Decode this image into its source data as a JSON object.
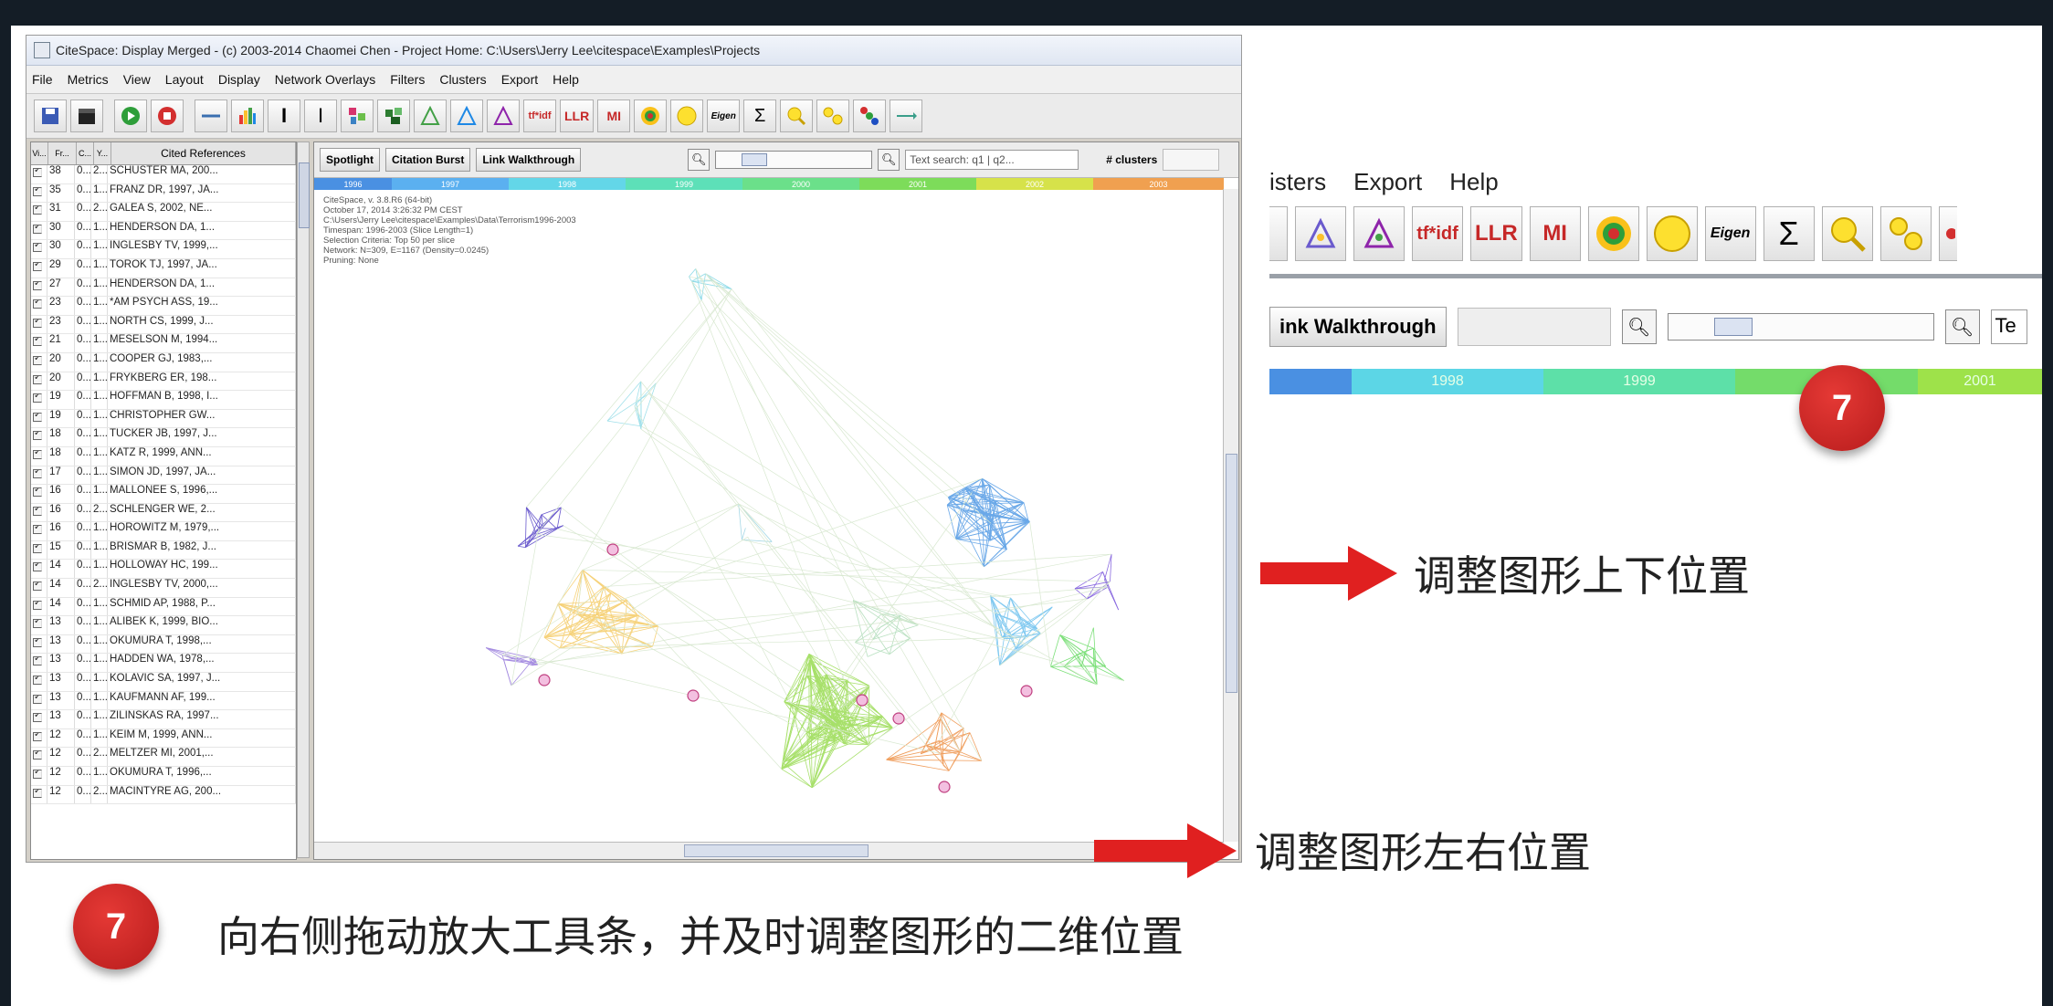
{
  "window": {
    "title": "CiteSpace: Display Merged - (c) 2003-2014 Chaomei Chen - Project Home: C:\\Users\\Jerry Lee\\citespace\\Examples\\Projects"
  },
  "menu": [
    "File",
    "Metrics",
    "View",
    "Layout",
    "Display",
    "Network Overlays",
    "Filters",
    "Clusters",
    "Export",
    "Help"
  ],
  "toolbar_text": {
    "tfidf": "tf*idf",
    "llr": "LLR",
    "mi": "MI",
    "eigen": "Eigen",
    "sigma": "Σ"
  },
  "table": {
    "headers": [
      "Vi...",
      "Fr...",
      "C...",
      "Y...",
      "Cited References"
    ],
    "rows": [
      {
        "freq": "38",
        "c": "0...",
        "y": "2...",
        "ref": "SCHUSTER MA, 200..."
      },
      {
        "freq": "35",
        "c": "0...",
        "y": "1...",
        "ref": "FRANZ DR, 1997, JA..."
      },
      {
        "freq": "31",
        "c": "0...",
        "y": "2...",
        "ref": "GALEA S, 2002, NE..."
      },
      {
        "freq": "30",
        "c": "0...",
        "y": "1...",
        "ref": "HENDERSON DA, 1..."
      },
      {
        "freq": "30",
        "c": "0...",
        "y": "1...",
        "ref": "INGLESBY TV, 1999,..."
      },
      {
        "freq": "29",
        "c": "0...",
        "y": "1...",
        "ref": "TOROK TJ, 1997, JA..."
      },
      {
        "freq": "27",
        "c": "0...",
        "y": "1...",
        "ref": "HENDERSON DA, 1..."
      },
      {
        "freq": "23",
        "c": "0...",
        "y": "1...",
        "ref": "*AM PSYCH ASS, 19..."
      },
      {
        "freq": "23",
        "c": "0...",
        "y": "1...",
        "ref": "NORTH CS, 1999, J..."
      },
      {
        "freq": "21",
        "c": "0...",
        "y": "1...",
        "ref": "MESELSON M, 1994..."
      },
      {
        "freq": "20",
        "c": "0...",
        "y": "1...",
        "ref": "COOPER GJ, 1983,..."
      },
      {
        "freq": "20",
        "c": "0...",
        "y": "1...",
        "ref": "FRYKBERG ER, 198..."
      },
      {
        "freq": "19",
        "c": "0...",
        "y": "1...",
        "ref": "HOFFMAN B, 1998, I..."
      },
      {
        "freq": "19",
        "c": "0...",
        "y": "1...",
        "ref": "CHRISTOPHER GW..."
      },
      {
        "freq": "18",
        "c": "0...",
        "y": "1...",
        "ref": "TUCKER JB, 1997, J..."
      },
      {
        "freq": "18",
        "c": "0...",
        "y": "1...",
        "ref": "KATZ R, 1999, ANN..."
      },
      {
        "freq": "17",
        "c": "0...",
        "y": "1...",
        "ref": "SIMON JD, 1997, JA..."
      },
      {
        "freq": "16",
        "c": "0...",
        "y": "1...",
        "ref": "MALLONEE S, 1996,..."
      },
      {
        "freq": "16",
        "c": "0...",
        "y": "2...",
        "ref": "SCHLENGER WE, 2..."
      },
      {
        "freq": "16",
        "c": "0...",
        "y": "1...",
        "ref": "HOROWITZ M, 1979,..."
      },
      {
        "freq": "15",
        "c": "0...",
        "y": "1...",
        "ref": "BRISMAR B, 1982, J..."
      },
      {
        "freq": "14",
        "c": "0...",
        "y": "1...",
        "ref": "HOLLOWAY HC, 199..."
      },
      {
        "freq": "14",
        "c": "0...",
        "y": "2...",
        "ref": "INGLESBY TV, 2000,..."
      },
      {
        "freq": "14",
        "c": "0...",
        "y": "1...",
        "ref": "SCHMID AP, 1988, P..."
      },
      {
        "freq": "13",
        "c": "0...",
        "y": "1...",
        "ref": "ALIBEK K, 1999, BIO..."
      },
      {
        "freq": "13",
        "c": "0...",
        "y": "1...",
        "ref": "OKUMURA T, 1998,..."
      },
      {
        "freq": "13",
        "c": "0...",
        "y": "1...",
        "ref": "HADDEN WA, 1978,..."
      },
      {
        "freq": "13",
        "c": "0...",
        "y": "1...",
        "ref": "KOLAVIC SA, 1997, J..."
      },
      {
        "freq": "13",
        "c": "0...",
        "y": "1...",
        "ref": "KAUFMANN AF, 199..."
      },
      {
        "freq": "13",
        "c": "0...",
        "y": "1...",
        "ref": "ZILINSKAS RA, 1997..."
      },
      {
        "freq": "12",
        "c": "0...",
        "y": "1...",
        "ref": "KEIM M, 1999, ANN..."
      },
      {
        "freq": "12",
        "c": "0...",
        "y": "2...",
        "ref": "MELTZER MI, 2001,..."
      },
      {
        "freq": "12",
        "c": "0...",
        "y": "1...",
        "ref": "OKUMURA T, 1996,..."
      },
      {
        "freq": "12",
        "c": "0...",
        "y": "2...",
        "ref": "MACINTYRE AG, 200..."
      }
    ]
  },
  "viz_toolbar": {
    "spotlight": "Spotlight",
    "citation_burst": "Citation Burst",
    "link_walkthrough": "Link Walkthrough",
    "search_placeholder": "Text search: q1 | q2...",
    "clusters_label": "# clusters"
  },
  "timeline": [
    {
      "year": "1996",
      "color": "#4a90e2"
    },
    {
      "year": "1997",
      "color": "#5bb0f0"
    },
    {
      "year": "1998",
      "color": "#63d6e8"
    },
    {
      "year": "1999",
      "color": "#5de0b8"
    },
    {
      "year": "2000",
      "color": "#6be08a"
    },
    {
      "year": "2001",
      "color": "#7ddc5a"
    },
    {
      "year": "2002",
      "color": "#d6e24a"
    },
    {
      "year": "2003",
      "color": "#f0a050"
    }
  ],
  "network_info": [
    "CiteSpace, v. 3.8.R6 (64-bit)",
    "October 17, 2014 3:26:32 PM CEST",
    "C:\\Users\\Jerry Lee\\citespace\\Examples\\Data\\Terrorism1996-2003",
    "Timespan: 1996-2003 (Slice Length=1)",
    "Selection Criteria: Top 50 per slice",
    "Network: N=309, E=1167 (Density=0.0245)",
    "Pruning: None"
  ],
  "inset": {
    "menu": [
      "isters",
      "Export",
      "Help"
    ],
    "link_walkthrough": "ink Walkthrough",
    "text_field": "Te",
    "timeline": [
      {
        "year": "",
        "color": "#4a90e2"
      },
      {
        "year": "1998",
        "color": "#5cd6e6"
      },
      {
        "year": "1999",
        "color": "#5de0a8"
      },
      {
        "year": "20..",
        "color": "#74dc6a"
      },
      {
        "year": "2001",
        "color": "#9ee24a"
      }
    ]
  },
  "annotations": {
    "vertical_label": "调整图形上下位置",
    "horizontal_label": "调整图形左右位置",
    "badge_number": "7",
    "caption": "向右侧拖动放大工具条，并及时调整图形的二维位置"
  },
  "colors": {
    "badge": "#d32f2f",
    "arrow": "#e02020",
    "frame": "#141d26"
  }
}
